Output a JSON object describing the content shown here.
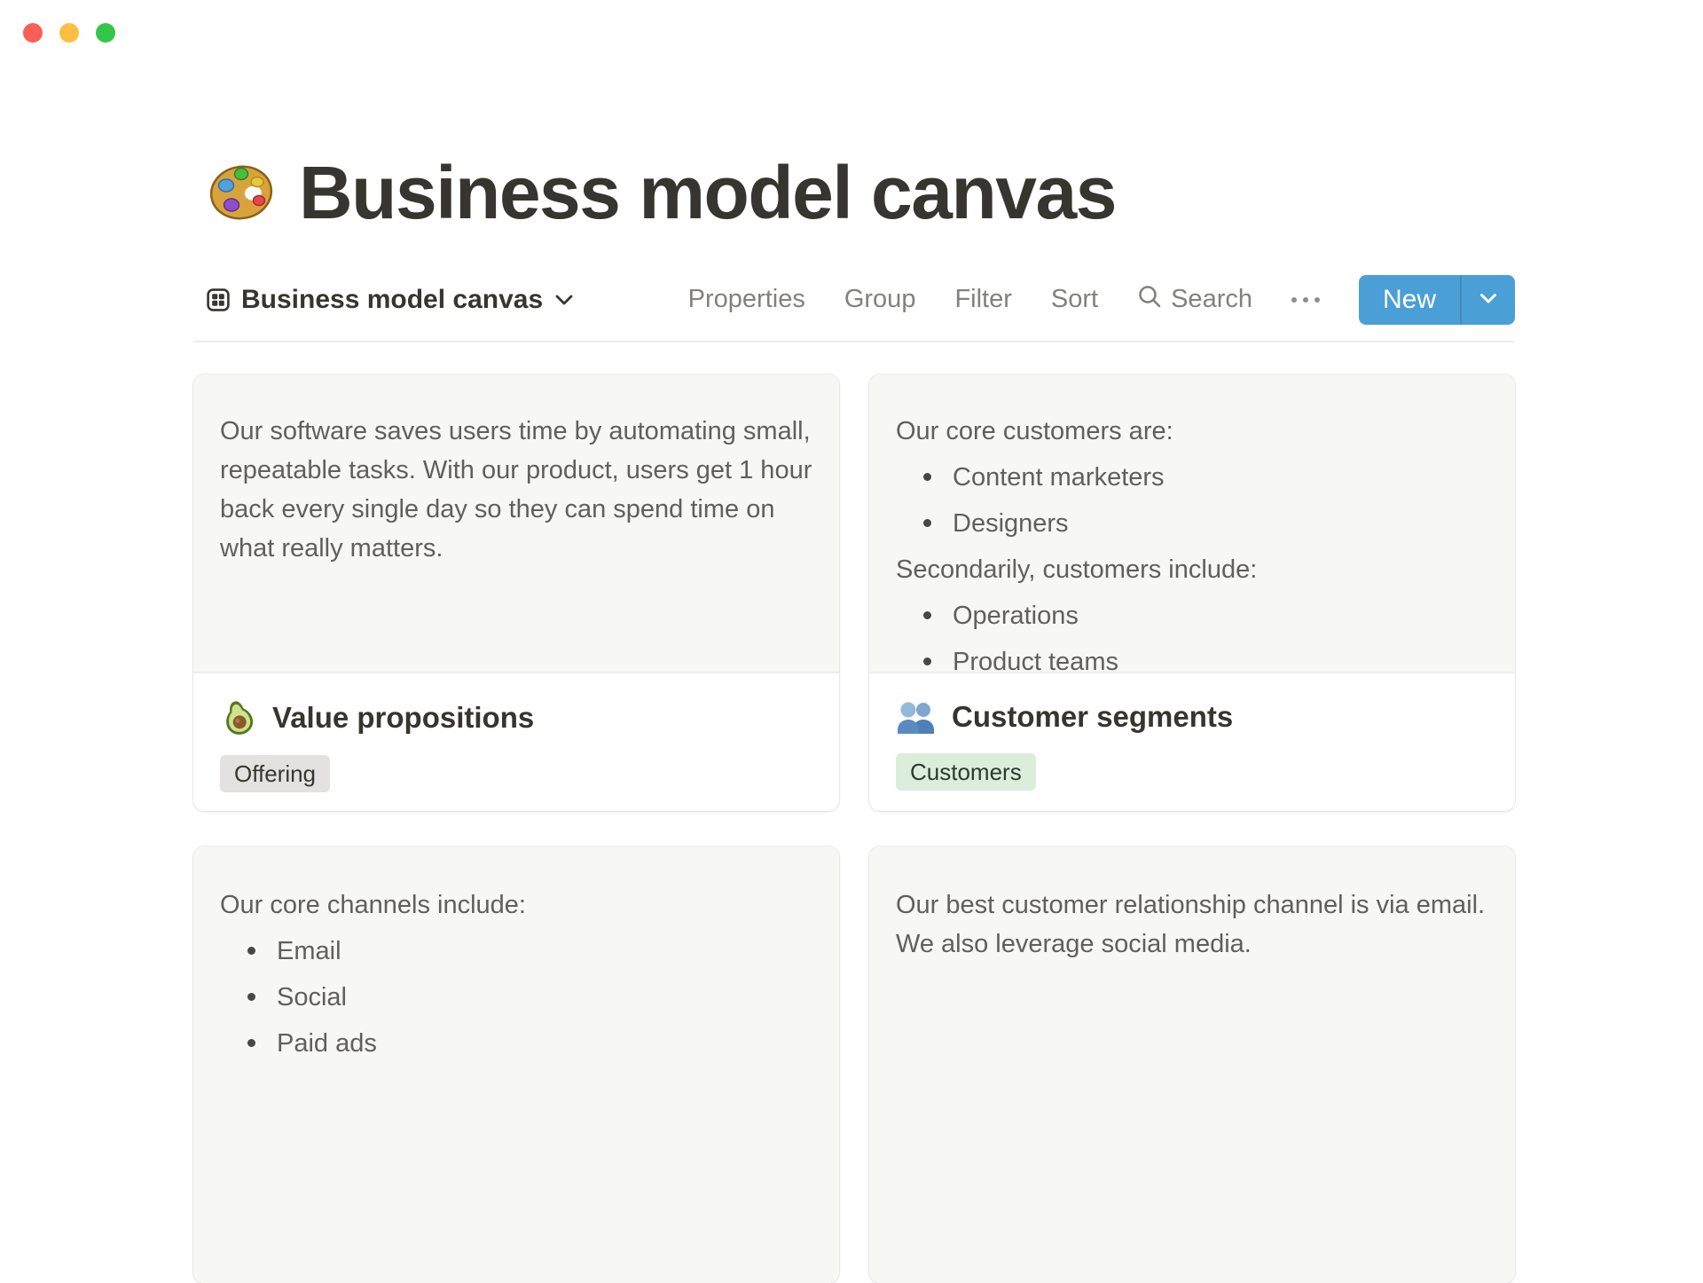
{
  "window": {
    "controls": [
      {
        "name": "close",
        "color": "#FC5F57"
      },
      {
        "name": "minimize",
        "color": "#FDBE41"
      },
      {
        "name": "zoom",
        "color": "#33C748"
      }
    ]
  },
  "page": {
    "icon": "palette-emoji-icon",
    "title": "Business model canvas"
  },
  "toolbar": {
    "view_icon": "gallery-view-icon",
    "view_name": "Business model canvas",
    "view_chevron_icon": "chevron-down-icon",
    "properties": "Properties",
    "group": "Group",
    "filter": "Filter",
    "sort": "Sort",
    "search_icon": "search-icon",
    "search_label": "Search",
    "more_icon": "ellipsis-icon",
    "new_label": "New",
    "new_button_color": "#4AA0D6"
  },
  "cards": [
    {
      "icon": "avocado-emoji-icon",
      "title": "Value propositions",
      "tag": {
        "label": "Offering",
        "bg": "#E3E2E0",
        "text_color": "#38362F"
      },
      "blocks": [
        {
          "type": "paragraph",
          "text": "Our software saves users time by automating small, repeatable tasks. With our product, users get 1 hour back every single day so they can spend time on what really matters."
        }
      ]
    },
    {
      "icon": "people-emoji-icon",
      "title": "Customer segments",
      "tag": {
        "label": "Customers",
        "bg": "#DBEDDB",
        "text_color": "#2C3A30"
      },
      "blocks": [
        {
          "type": "paragraph",
          "text": "Our core customers are:"
        },
        {
          "type": "bullet",
          "text": "Content marketers"
        },
        {
          "type": "bullet",
          "text": "Designers"
        },
        {
          "type": "paragraph",
          "text": "Secondarily, customers include:"
        },
        {
          "type": "bullet",
          "text": "Operations"
        },
        {
          "type": "bullet",
          "text": "Product teams"
        }
      ]
    },
    {
      "blocks": [
        {
          "type": "paragraph",
          "text": "Our core channels include:"
        },
        {
          "type": "bullet",
          "text": "Email"
        },
        {
          "type": "bullet",
          "text": "Social"
        },
        {
          "type": "bullet",
          "text": "Paid ads"
        }
      ]
    },
    {
      "blocks": [
        {
          "type": "paragraph",
          "text": "Our best customer relationship channel is via email. We also leverage social media."
        }
      ]
    }
  ],
  "colors": {
    "preview_bg": "#F7F7F5",
    "card_border": "#E9E8E6",
    "divider": "#EDECEA",
    "text_dark": "#37352F",
    "text_body": "#605F5B",
    "toolbar_gray": "#82817D"
  }
}
